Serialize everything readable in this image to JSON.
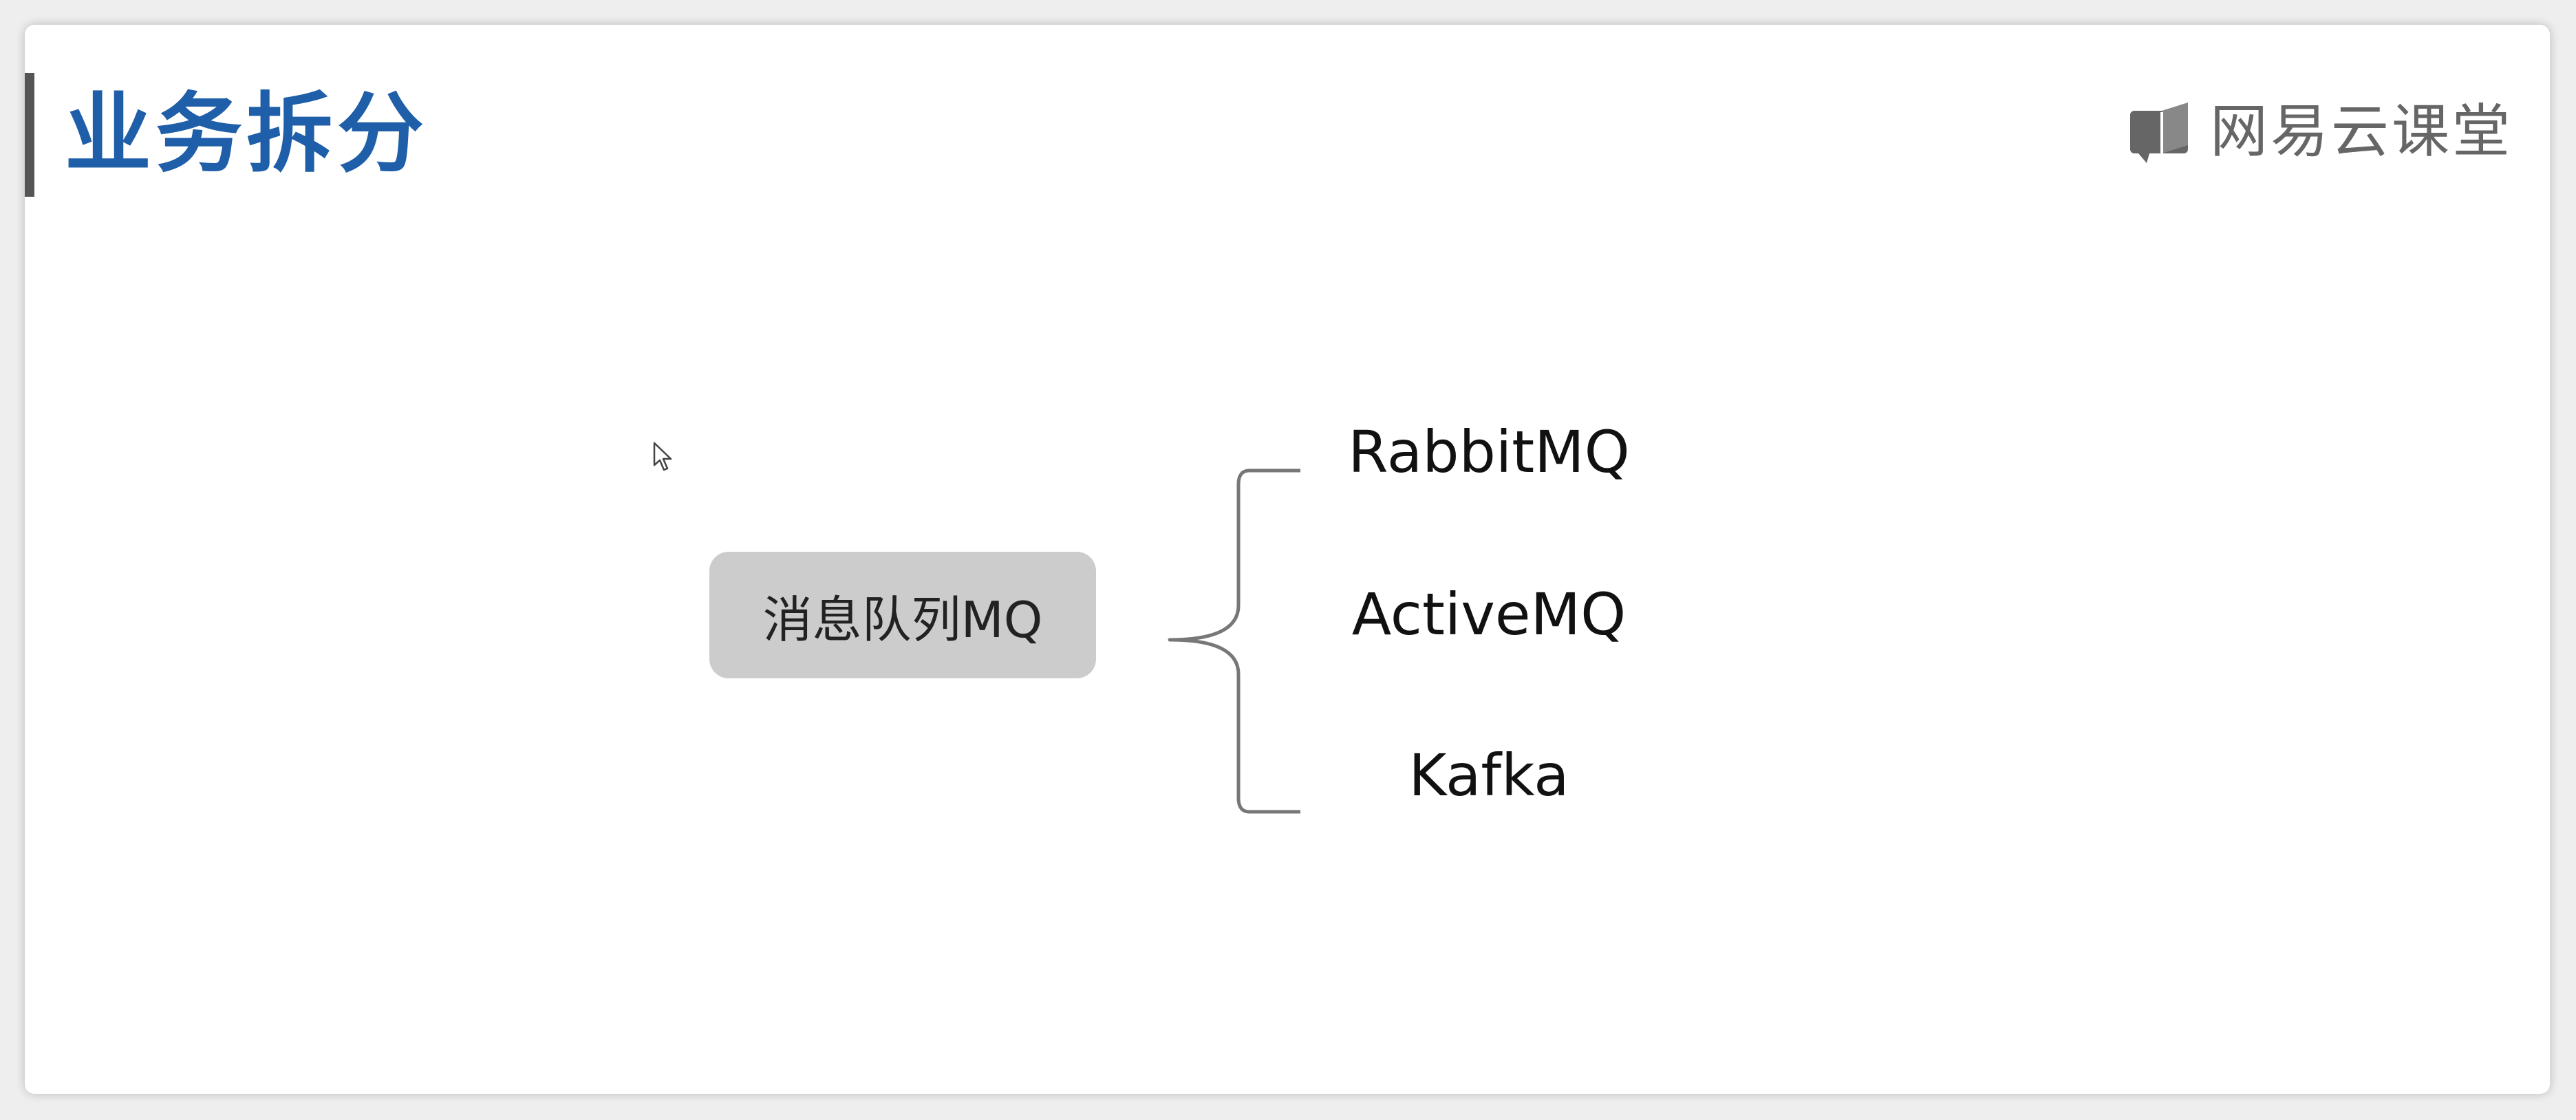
{
  "slide": {
    "title": "业务拆分",
    "logo_text": "网易云课堂"
  },
  "diagram": {
    "central": "消息队列MQ",
    "branches": [
      "RabbitMQ",
      "ActiveMQ",
      "Kafka"
    ]
  },
  "colors": {
    "title": "#1f5ea8",
    "node_fill": "#cccccc",
    "title_bar": "#555555",
    "logo": "#666666"
  }
}
